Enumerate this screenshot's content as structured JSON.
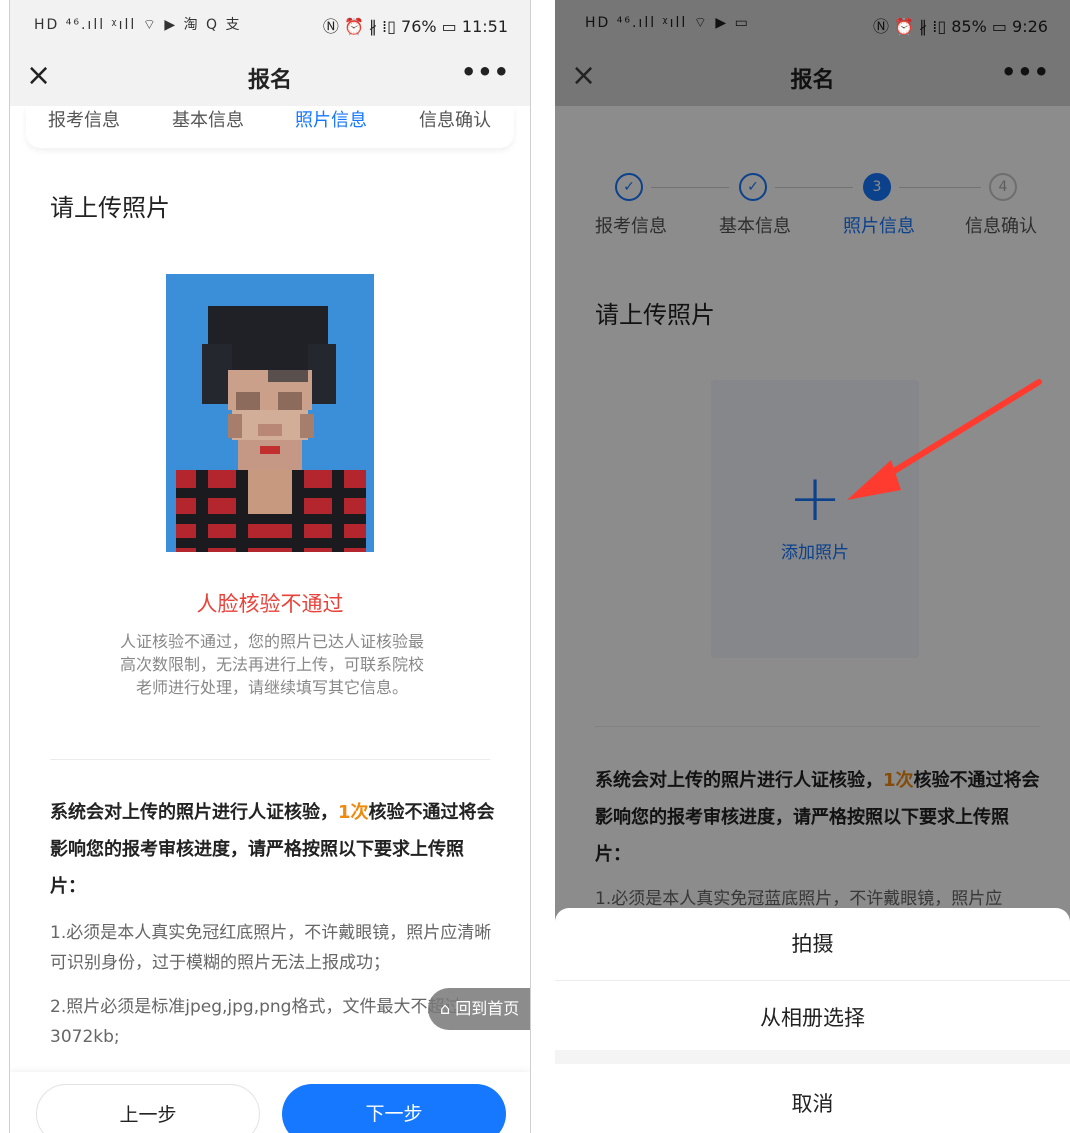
{
  "left_phone": {
    "status": {
      "left_icons": "HD ⁴⁶.ıll ᵡıll ⌔ ▶ 淘 Q 支",
      "right": "Ⓝ ⏰ ∦ ⁞▯ 76% ▭ 11:51"
    },
    "title": "报名",
    "close_icon": "×",
    "more_icon": "•••",
    "steps": [
      "报考信息",
      "基本信息",
      "照片信息",
      "信息确认"
    ],
    "section_title": "请上传照片",
    "fail_title": "人脸核验不通过",
    "fail_desc": "人证核验不通过，您的照片已达人证核验最高次数限制，无法再进行上传，可联系院校老师进行处理，请继续填写其它信息。",
    "req_pre": "系统会对上传的照片进行人证核验，",
    "req_count": "1次",
    "req_post": "核验不通过将会影响您的报考审核进度，请严格按照以下要求上传照片：",
    "req_item_1": "1.必须是本人真实免冠红底照片，不许戴眼镜，照片应清晰可识别身份，过于模糊的照片无法上报成功；",
    "req_item_2": "2.照片必须是标准jpeg,jpg,png格式，文件最大不超过3072kb;",
    "home_btn": "回到首页",
    "prev_btn": "上一步",
    "next_btn": "下一步"
  },
  "right_phone": {
    "status": {
      "left_icons": "HD ⁴⁶.ıll ᵡıll ⌔ ▶ ▭",
      "right": "Ⓝ ⏰ ∦ ⁞▯ 85% ▭ 9:26"
    },
    "title": "报名",
    "close_icon": "×",
    "more_icon": "•••",
    "steps": [
      "报考信息",
      "基本信息",
      "照片信息",
      "信息确认"
    ],
    "step_numbers": [
      "✓",
      "✓",
      "3",
      "4"
    ],
    "section_title": "请上传照片",
    "add_plus": "+",
    "add_label": "添加照片",
    "req_pre": "系统会对上传的照片进行人证核验，",
    "req_count": "1次",
    "req_post": "核验不通过将会影响您的报考审核进度，请严格按照以下要求上传照片：",
    "req_item_1": "1.必须是本人真实免冠蓝底照片，不许戴眼镜，照片应",
    "sheet": [
      "拍摄",
      "从相册选择",
      "取消"
    ]
  },
  "colors": {
    "primary": "#1677ff",
    "error": "#e8433b",
    "highlight": "#f08a0f",
    "photo_bg": "#3b8fd9"
  }
}
